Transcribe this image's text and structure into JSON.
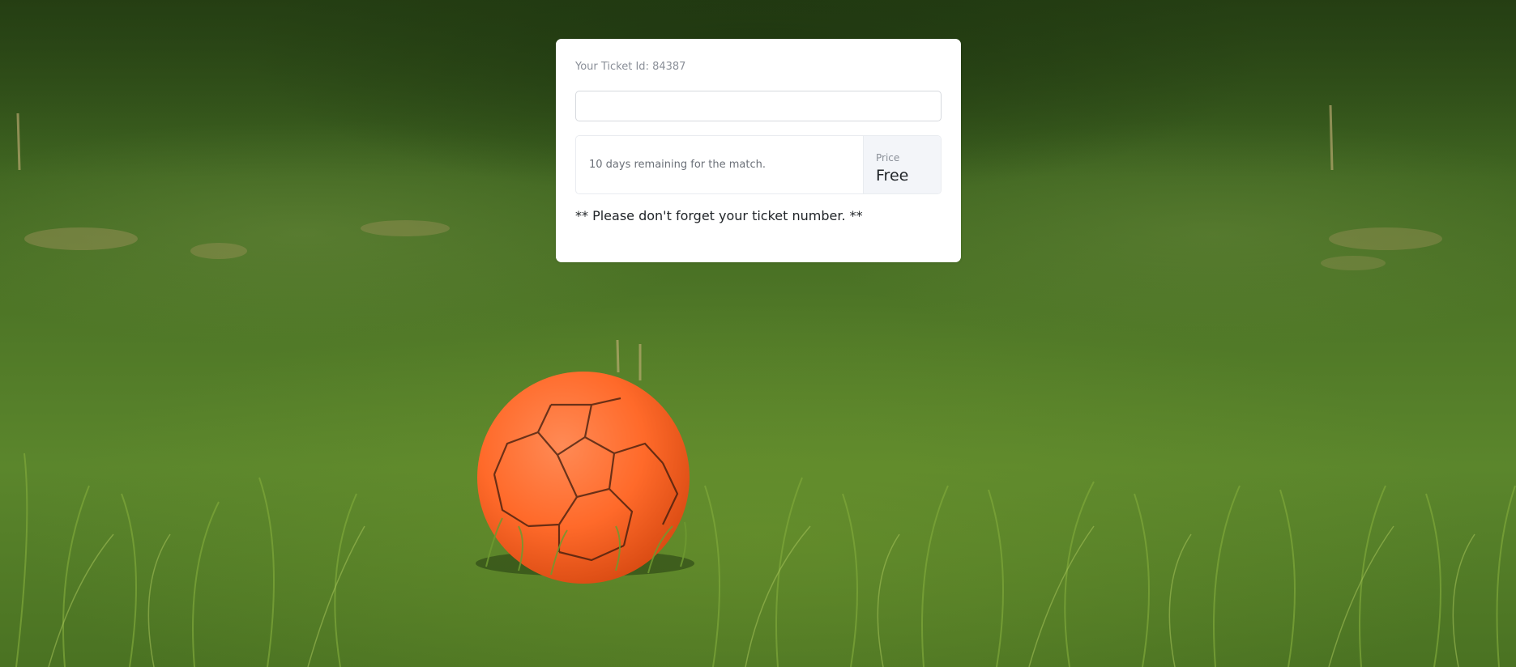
{
  "ticket": {
    "id_label": "Your Ticket Id: 84387",
    "input_value": "",
    "input_placeholder": ""
  },
  "match": {
    "remaining_text": "10 days remaining for the match."
  },
  "price": {
    "label": "Price",
    "value": "Free"
  },
  "notice": {
    "text": "** Please don't forget your ticket number. **"
  },
  "background": {
    "scene": "soccer-ball-on-grass",
    "ball_color": "#ff6a2a",
    "grass_color": "#4d7526"
  }
}
